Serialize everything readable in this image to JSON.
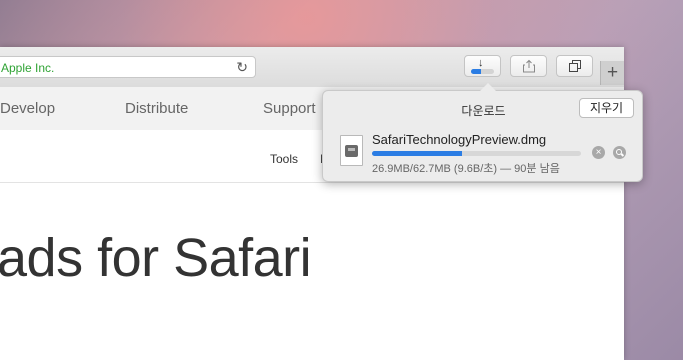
{
  "toolbar": {
    "address_text": "Apple Inc.",
    "reload_icon": "reload-icon",
    "download_progress": 0.43,
    "share_icon": "share-icon",
    "tabs_icon": "show-tabs-icon",
    "new_tab_label": "+"
  },
  "nav": {
    "items": [
      "Develop",
      "Distribute",
      "Support"
    ]
  },
  "subnav": {
    "items": [
      "Tools",
      "I"
    ]
  },
  "page": {
    "hero_title": "ads for Safari"
  },
  "downloads": {
    "title": "다운로드",
    "clear_label": "지우기",
    "item": {
      "filename": "SafariTechnologyPreview.dmg",
      "progress": 0.43,
      "status": "26.9MB/62.7MB (9.6B/초) — 90분 남음",
      "stop_icon": "stop-icon",
      "reveal_icon": "magnifier-icon"
    }
  },
  "colors": {
    "accent": "#2b7de4",
    "secure_text": "#2fa334"
  }
}
